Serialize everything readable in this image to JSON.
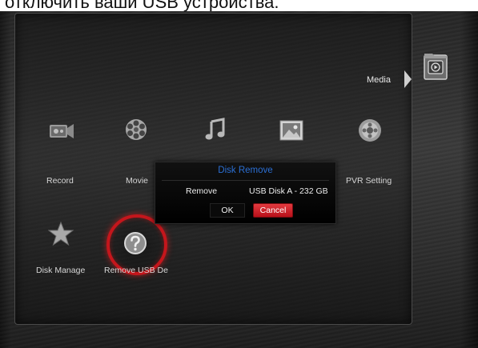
{
  "caption": "отключить ваши USB устройства.",
  "header": {
    "section_label": "Media",
    "section_icon": "media-folder-icon"
  },
  "menu": {
    "items": [
      {
        "label": "Record",
        "icon": "camera-icon"
      },
      {
        "label": "Movie",
        "icon": "film-reel-icon"
      },
      {
        "label": "",
        "icon": "music-note-icon"
      },
      {
        "label": "",
        "icon": "picture-icon"
      },
      {
        "label": "PVR Setting",
        "icon": "disc-settings-icon"
      },
      {
        "label": "Disk Manage",
        "icon": "star-icon"
      },
      {
        "label": "Remove USB De",
        "icon": "question-mark-icon",
        "selected": true
      }
    ]
  },
  "dialog": {
    "title": "Disk Remove",
    "field_label": "Remove",
    "field_value": "USB Disk A - 232 GB",
    "ok_label": "OK",
    "cancel_label": "Cancel",
    "focused_button": "Cancel"
  },
  "colors": {
    "dialog_title": "#2b6fd4",
    "cancel_button": "#c8161e",
    "selection_ring": "#c4161c"
  }
}
